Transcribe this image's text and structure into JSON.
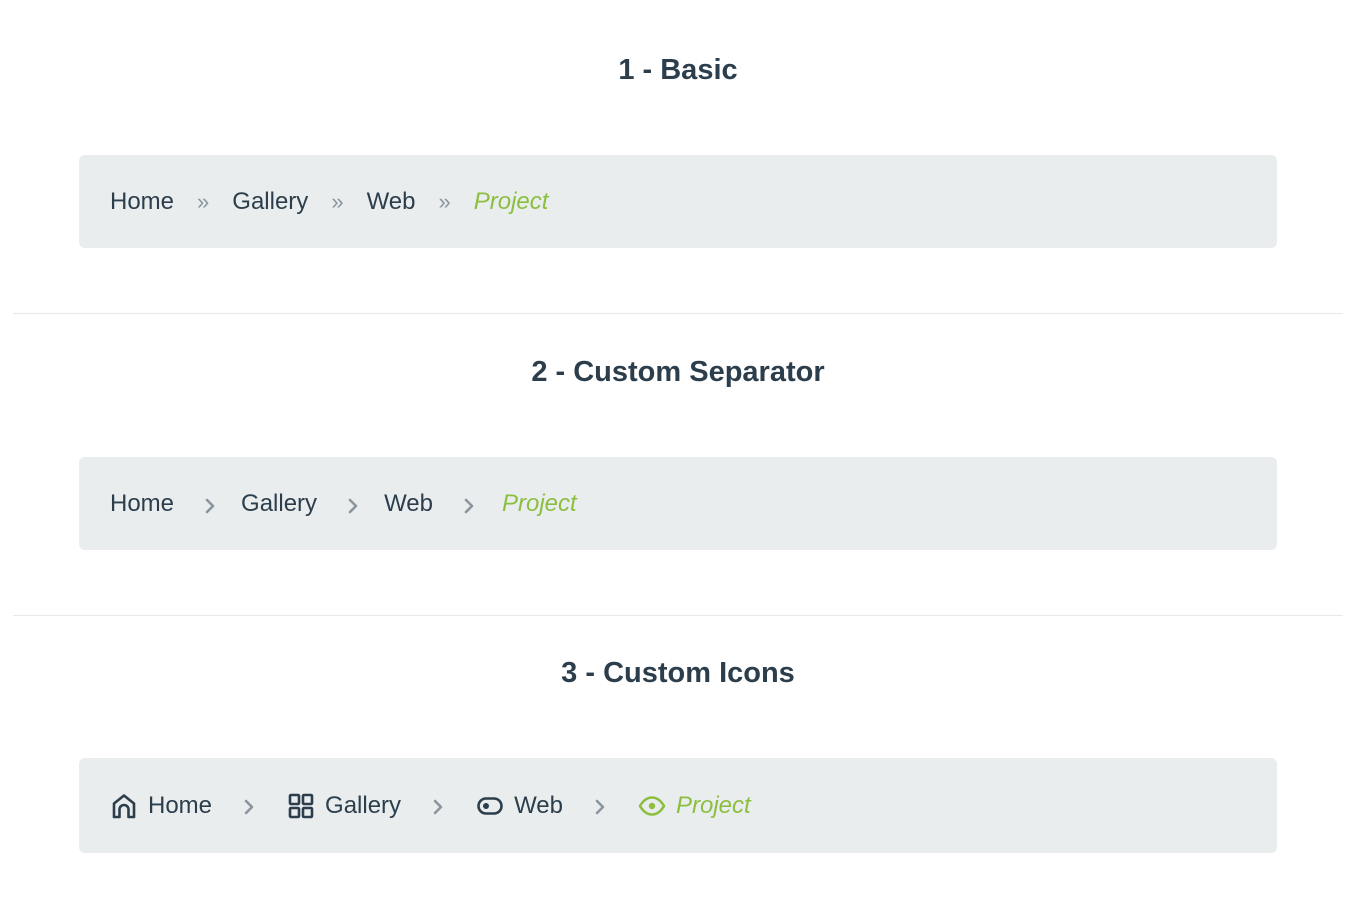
{
  "sections": [
    {
      "title": "1 - Basic",
      "separator": "»",
      "items": [
        "Home",
        "Gallery",
        "Web",
        "Project"
      ]
    },
    {
      "title": "2 - Custom Separator",
      "separator": "chevron-right",
      "items": [
        "Home",
        "Gallery",
        "Web",
        "Project"
      ]
    },
    {
      "title": "3 - Custom Icons",
      "separator": "chevron-right",
      "items": [
        {
          "label": "Home",
          "icon": "home-icon"
        },
        {
          "label": "Gallery",
          "icon": "grid-icon"
        },
        {
          "label": "Web",
          "icon": "toggle-icon"
        },
        {
          "label": "Project",
          "icon": "eye-icon"
        }
      ]
    }
  ],
  "colors": {
    "text": "#2c3e4c",
    "active": "#8cbf3f",
    "separator": "#8a959e",
    "bar_background": "#e9edee",
    "divider": "#e6e9eb"
  }
}
